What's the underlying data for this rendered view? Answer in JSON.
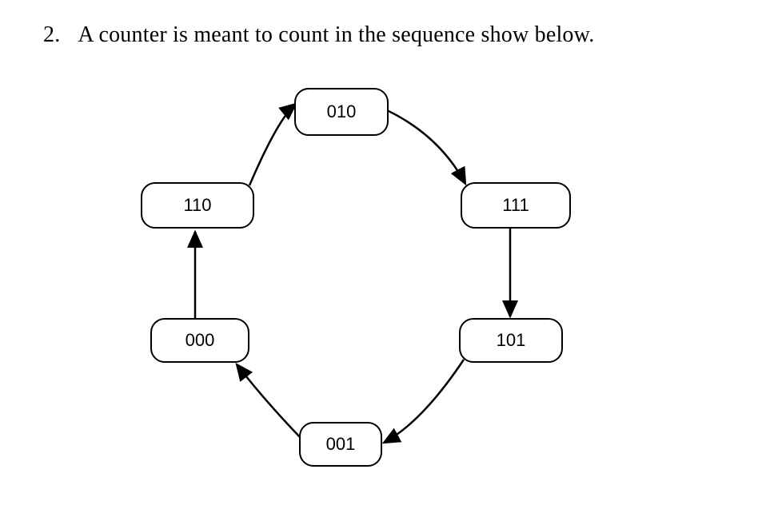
{
  "question": {
    "number": "2.",
    "text": "A counter is meant to count  in the sequence show below."
  },
  "diagram": {
    "type": "state-diagram",
    "states": {
      "s010": "010",
      "s110": "110",
      "s111": "111",
      "s000": "000",
      "s101": "101",
      "s001": "001"
    },
    "transitions": [
      {
        "from": "000",
        "to": "110"
      },
      {
        "from": "110",
        "to": "010"
      },
      {
        "from": "010",
        "to": "111"
      },
      {
        "from": "111",
        "to": "101"
      },
      {
        "from": "101",
        "to": "001"
      },
      {
        "from": "001",
        "to": "000"
      }
    ]
  }
}
